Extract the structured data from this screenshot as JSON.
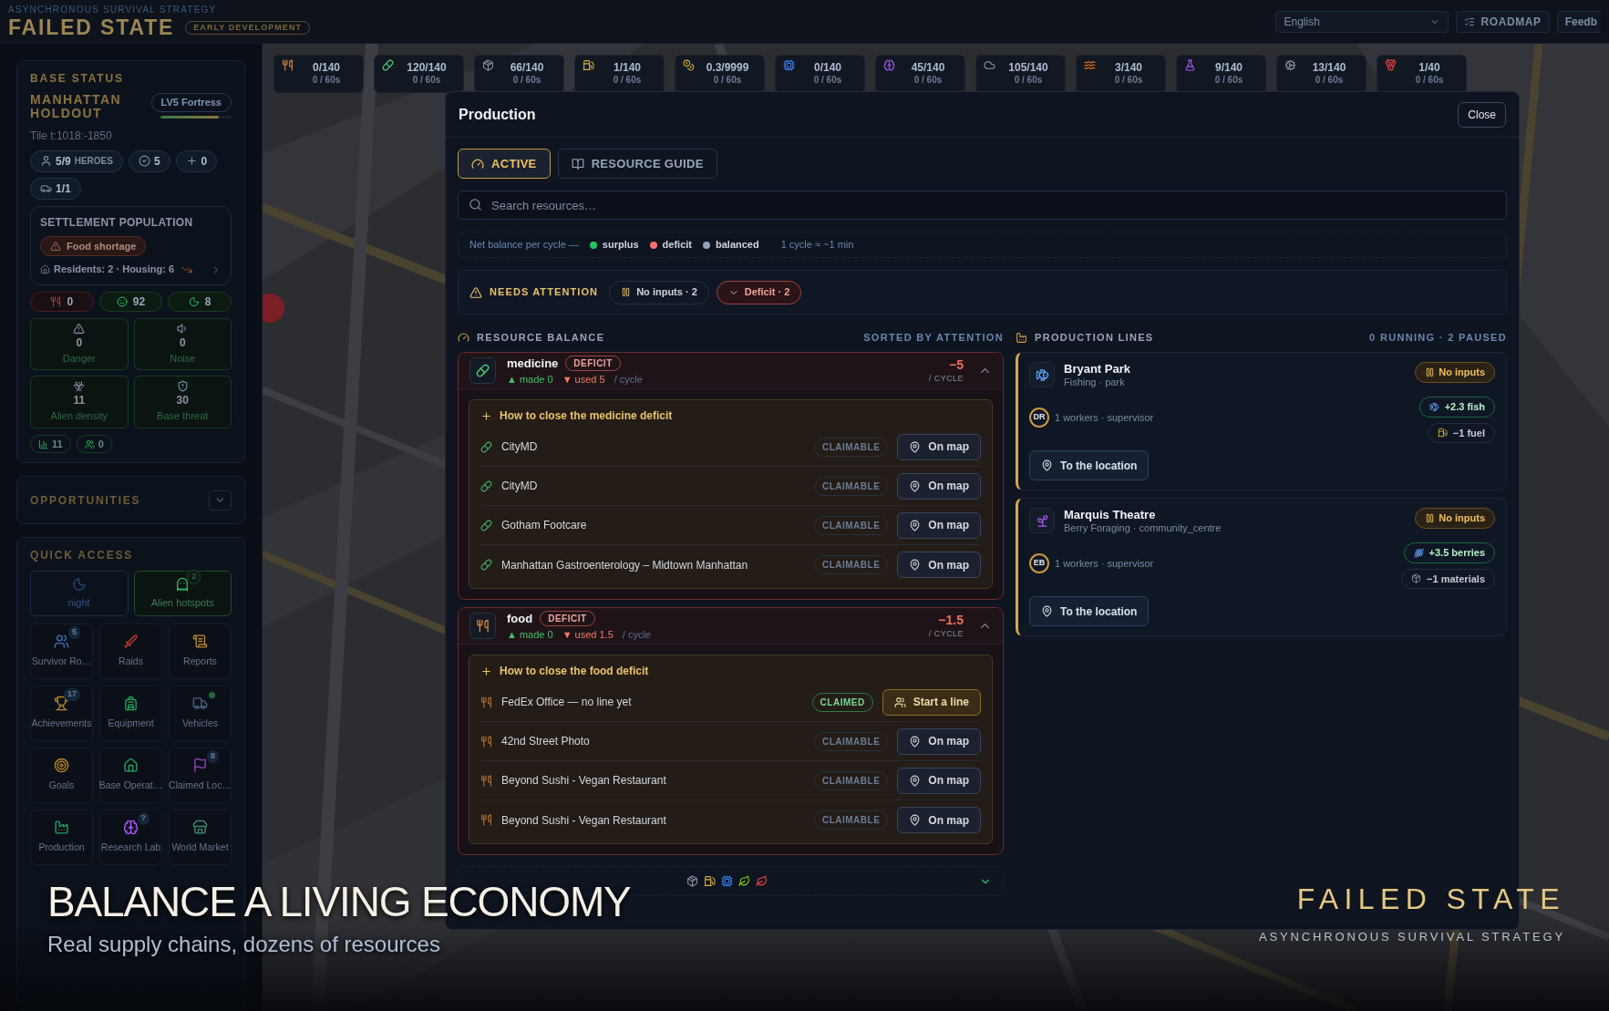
{
  "header": {
    "tagline": "ASYNCHRONOUS SURVIVAL STRATEGY",
    "title": "FAILED STATE",
    "badge": "EARLY DEVELOPMENT",
    "language": "English",
    "roadmap": "ROADMAP",
    "feedback": "Feedb"
  },
  "base_status": {
    "heading": "BASE STATUS",
    "name": "MANHATTAN HOLDOUT",
    "level_badge": "LV5 Fortress",
    "level": 0.82,
    "tile": "Tile t:1018:-1850",
    "chips": [
      {
        "kind": "user",
        "value": "5/9",
        "label": "HEROES"
      },
      {
        "kind": "check",
        "value": "5"
      },
      {
        "kind": "medic",
        "value": "0"
      },
      {
        "kind": "car",
        "value": "1/1"
      }
    ]
  },
  "settlement": {
    "heading": "SETTLEMENT POPULATION",
    "alert": "Food shortage",
    "summary": "Residents: 2 · Housing: 6"
  },
  "vitals": [
    {
      "kind": "food",
      "value": "0",
      "alert": true
    },
    {
      "kind": "smile",
      "value": "92",
      "alert": false
    },
    {
      "kind": "moon",
      "value": "8",
      "alert": false
    }
  ],
  "metrics": [
    {
      "kind": "danger",
      "value": "0",
      "label": "Danger"
    },
    {
      "kind": "noise",
      "value": "0",
      "label": "Noise"
    },
    {
      "kind": "biohazard",
      "value": "11",
      "label": "Alien density"
    },
    {
      "kind": "shield",
      "value": "30",
      "label": "Base threat"
    }
  ],
  "mini_chips": [
    {
      "kind": "bars",
      "value": "11"
    },
    {
      "kind": "group",
      "value": "0"
    }
  ],
  "opportunities": {
    "heading": "OPPORTUNITIES",
    "expanded": false
  },
  "quick_access": {
    "heading": "QUICK ACCESS",
    "wide": [
      {
        "kind": "night",
        "label": "night"
      },
      {
        "kind": "alien",
        "label": "Alien hotspots",
        "badge": "2"
      }
    ],
    "tiles": [
      {
        "kind": "users",
        "label": "Survivor Ro…",
        "badge": "5",
        "dot": false
      },
      {
        "kind": "sword",
        "label": "Raids",
        "dot": false
      },
      {
        "kind": "scroll",
        "label": "Reports",
        "dot": false
      },
      {
        "kind": "trophy",
        "label": "Achievements",
        "badge": "17",
        "dot": false
      },
      {
        "kind": "backpack",
        "label": "Equipment",
        "dot": false
      },
      {
        "kind": "truck",
        "label": "Vehicles",
        "dot": true
      },
      {
        "kind": "target",
        "label": "Goals",
        "dot": false
      },
      {
        "kind": "house",
        "label": "Base Operat…",
        "dot": false
      },
      {
        "kind": "flag",
        "label": "Claimed Loc…",
        "badge": "8",
        "dot": false
      },
      {
        "kind": "factory",
        "label": "Production",
        "dot": false
      },
      {
        "kind": "brain",
        "label": "Research Lab",
        "badge": "?",
        "dot": false
      },
      {
        "kind": "store",
        "label": "World Market",
        "dot": false
      }
    ]
  },
  "resources": [
    {
      "kind": "food",
      "amount": "0/140",
      "rate": "0 / 60s"
    },
    {
      "kind": "medicine",
      "amount": "120/140",
      "rate": "0 / 60s"
    },
    {
      "kind": "materials",
      "amount": "66/140",
      "rate": "0 / 60s"
    },
    {
      "kind": "fuel",
      "amount": "1/140",
      "rate": "0 / 60s"
    },
    {
      "kind": "coins",
      "amount": "0.3/9999",
      "rate": "0 / 60s"
    },
    {
      "kind": "electronics",
      "amount": "0/140",
      "rate": "0 / 60s"
    },
    {
      "kind": "brain",
      "amount": "45/140",
      "rate": "0 / 60s"
    },
    {
      "kind": "cloud",
      "amount": "105/140",
      "rate": "0 / 60s"
    },
    {
      "kind": "waves",
      "amount": "3/140",
      "rate": "0 / 60s"
    },
    {
      "kind": "flask",
      "amount": "9/140",
      "rate": "0 / 60s"
    },
    {
      "kind": "cog",
      "amount": "13/140",
      "rate": "0 / 60s"
    },
    {
      "kind": "medal",
      "amount": "1/40",
      "rate": "0 / 60s"
    }
  ],
  "production": {
    "title": "Production",
    "close": "Close",
    "tabs": [
      {
        "kind": "gauge",
        "label": "ACTIVE",
        "selected": true
      },
      {
        "kind": "book",
        "label": "RESOURCE GUIDE",
        "selected": false
      }
    ],
    "search": {
      "placeholder": "Search resources…"
    },
    "legend": {
      "label": "Net balance per cycle —",
      "items": [
        {
          "label": "surplus",
          "color": "#22c55e"
        },
        {
          "label": "deficit",
          "color": "#f87171"
        },
        {
          "label": "balanced",
          "color": "#94a3b8"
        }
      ],
      "note": "1 cycle ≈ ~1 min"
    },
    "attention": {
      "label": "NEEDS ATTENTION",
      "filters": [
        {
          "kind": "paused",
          "label": "No inputs · 2"
        },
        {
          "kind": "deficit",
          "label": "Deficit · 2"
        }
      ]
    },
    "balance": {
      "heading": "RESOURCE BALANCE",
      "sort": "SORTED BY ATTENTION",
      "items": [
        {
          "kind": "medicine",
          "name": "medicine",
          "status": "DEFICIT",
          "made": "▲ made 0",
          "used": "▼ used 5",
          "per": "/ cycle",
          "net": "−5",
          "unit": "/ CYCLE",
          "expanded": true,
          "help": {
            "title": "How to close the medicine deficit",
            "sources": [
              {
                "name": "CityMD",
                "badge": "CLAIMABLE",
                "claimed": false,
                "action": "On map"
              },
              {
                "name": "CityMD",
                "badge": "CLAIMABLE",
                "claimed": false,
                "action": "On map"
              },
              {
                "name": "Gotham Footcare",
                "badge": "CLAIMABLE",
                "claimed": false,
                "action": "On map"
              },
              {
                "name": "Manhattan Gastroenterology – Midtown Manhattan",
                "badge": "CLAIMABLE",
                "claimed": false,
                "action": "On map"
              }
            ]
          }
        },
        {
          "kind": "food",
          "name": "food",
          "status": "DEFICIT",
          "made": "▲ made 0",
          "used": "▼ used 1.5",
          "per": "/ cycle",
          "net": "−1.5",
          "unit": "/ CYCLE",
          "expanded": true,
          "help": {
            "title": "How to close the food deficit",
            "sources": [
              {
                "name": "FedEx Office — no line yet",
                "badge": "CLAIMED",
                "claimed": true,
                "action": "Start a line"
              },
              {
                "name": "42nd Street Photo",
                "badge": "CLAIMABLE",
                "claimed": false,
                "action": "On map"
              },
              {
                "name": "Beyond Sushi - Vegan Restaurant",
                "badge": "CLAIMABLE",
                "claimed": false,
                "action": "On map"
              },
              {
                "name": "Beyond Sushi - Vegan Restaurant",
                "badge": "CLAIMABLE",
                "claimed": false,
                "action": "On map"
              }
            ]
          }
        }
      ],
      "collapsed": {
        "icons": [
          {
            "kind": "materials"
          },
          {
            "kind": "fuel"
          },
          {
            "kind": "electronics"
          },
          {
            "kind": "leaf"
          },
          {
            "kind": "leaf_red"
          }
        ],
        "expanded": false
      }
    },
    "lines": {
      "heading": "PRODUCTION LINES",
      "summary": "0 RUNNING · 2 PAUSED",
      "items": [
        {
          "kind": "fish",
          "name": "Bryant Park",
          "sub": "Fishing · park",
          "status": "No inputs",
          "initials": "DR",
          "workers": "1 workers · supervisor",
          "action": "To the location",
          "flows": [
            {
              "kind": "fish",
              "text": "+2.3 fish",
              "gain": true
            },
            {
              "kind": "fuel",
              "text": "−1 fuel",
              "gain": false
            }
          ]
        },
        {
          "kind": "sprout",
          "name": "Marquis Theatre",
          "sub": "Berry Foraging · community_centre",
          "status": "No inputs",
          "initials": "EB",
          "workers": "1 workers · supervisor",
          "action": "To the location",
          "flows": [
            {
              "kind": "grape",
              "text": "+3.5 berries",
              "gain": true
            },
            {
              "kind": "materials",
              "text": "−1 materials",
              "gain": false
            }
          ]
        }
      ]
    }
  },
  "promo": {
    "headline": "BALANCE A LIVING ECONOMY",
    "subline": "Real supply chains, dozens of resources",
    "brand": "FAILED STATE",
    "brand_tagline": "ASYNCHRONOUS SURVIVAL STRATEGY"
  }
}
